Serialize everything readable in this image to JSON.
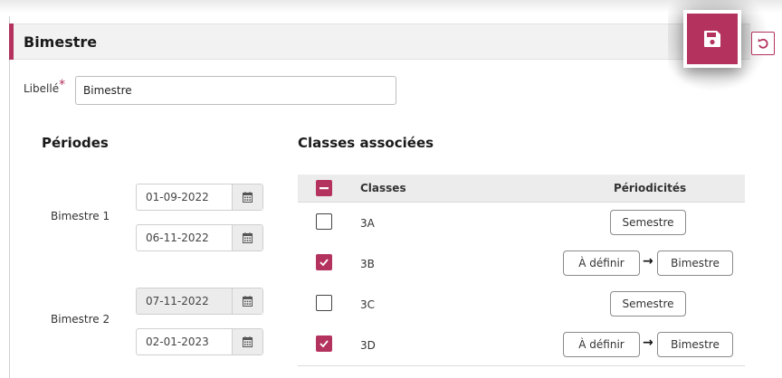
{
  "panel": {
    "title": "Bimestre"
  },
  "form": {
    "libelle_label": "Libellé",
    "required_mark": "*",
    "libelle_value": "Bimestre"
  },
  "periodes": {
    "title": "Périodes",
    "items": [
      {
        "label": "Bimestre 1",
        "start": "01-09-2022",
        "end": "06-11-2022",
        "start_disabled": false
      },
      {
        "label": "Bimestre 2",
        "start": "07-11-2022",
        "end": "02-01-2023",
        "start_disabled": true
      }
    ]
  },
  "classes": {
    "title": "Classes associées",
    "header": {
      "classes": "Classes",
      "periodicites": "Périodicités",
      "select_all": "indeterminate"
    },
    "rows": [
      {
        "name": "3A",
        "checked": false,
        "periodicites": [
          "Semestre"
        ]
      },
      {
        "name": "3B",
        "checked": true,
        "periodicites": [
          "À définir",
          "Bimestre"
        ]
      },
      {
        "name": "3C",
        "checked": false,
        "periodicites": [
          "Semestre"
        ]
      },
      {
        "name": "3D",
        "checked": true,
        "periodicites": [
          "À définir",
          "Bimestre"
        ]
      }
    ]
  },
  "icons": {
    "save": "floppy-disk-icon",
    "reset": "undo-icon",
    "calendar": "calendar-icon",
    "arrow": "arrow-right-icon"
  },
  "colors": {
    "accent": "#b4325e",
    "header_bg": "#f2f2f2",
    "table_header_bg": "#ececec"
  }
}
